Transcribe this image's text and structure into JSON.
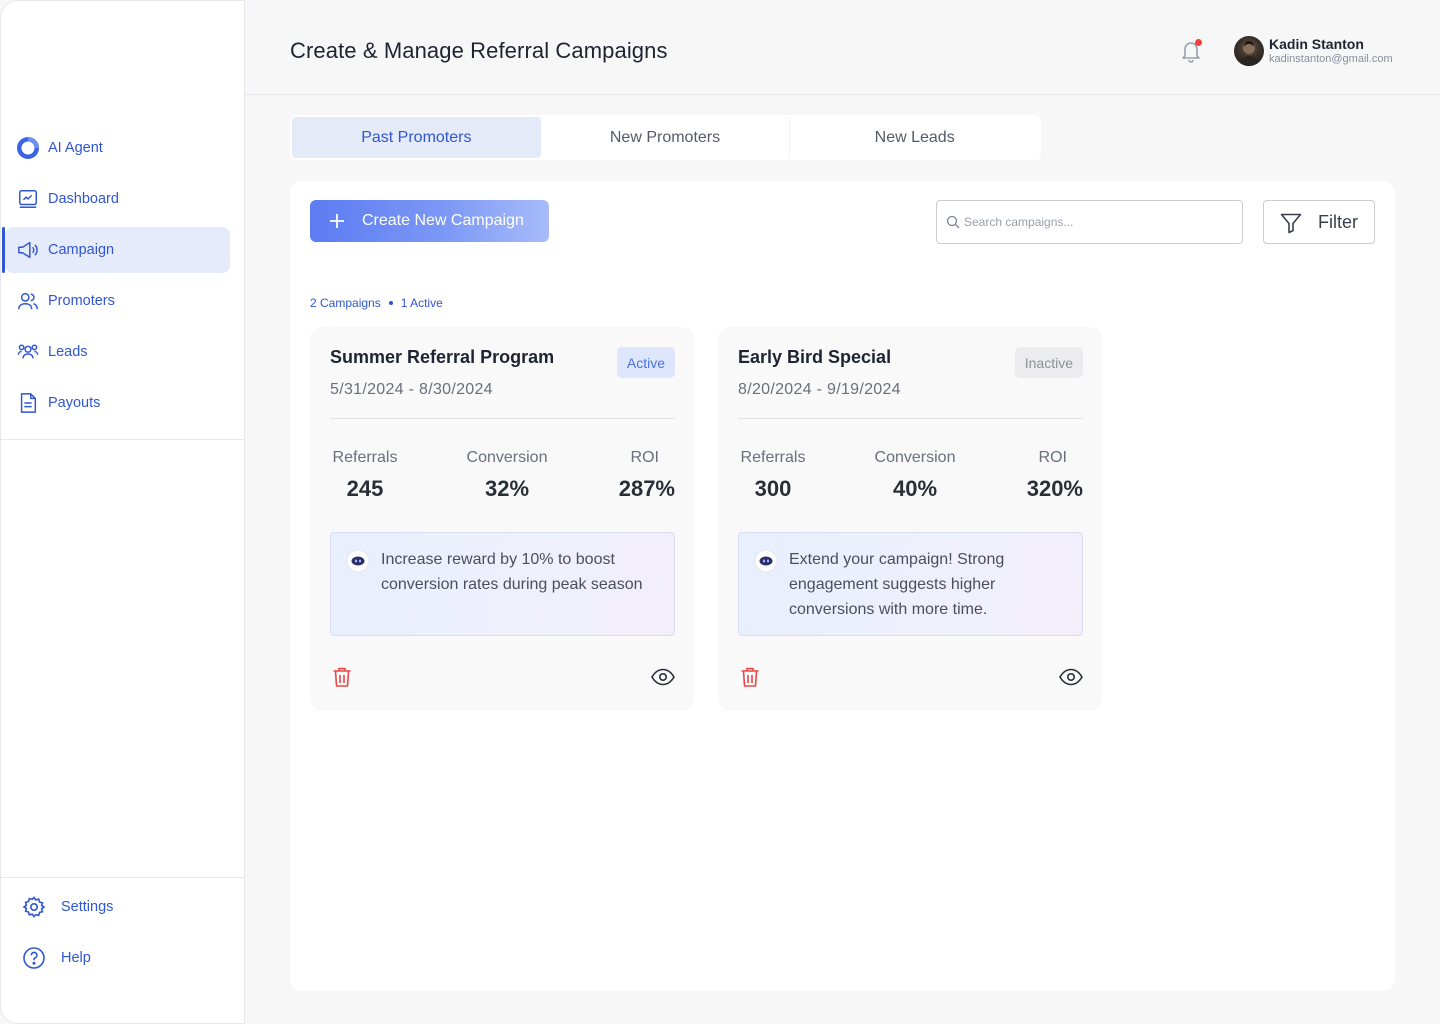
{
  "sidebar": {
    "items": [
      {
        "label": "AI Agent",
        "icon": "ai-agent-icon"
      },
      {
        "label": "Dashboard",
        "icon": "dashboard-icon"
      },
      {
        "label": "Campaign",
        "icon": "megaphone-icon",
        "active": true
      },
      {
        "label": "Promoters",
        "icon": "users-icon"
      },
      {
        "label": "Leads",
        "icon": "leads-icon"
      },
      {
        "label": "Payouts",
        "icon": "document-icon"
      }
    ],
    "bottom_items": [
      {
        "label": "Settings",
        "icon": "gear-icon"
      },
      {
        "label": "Help",
        "icon": "help-icon"
      }
    ]
  },
  "header": {
    "title": "Create & Manage Referral Campaigns",
    "user": {
      "name": "Kadin Stanton",
      "email": "kadinstanton@gmail.com"
    },
    "notification_dot": true
  },
  "tabs": [
    {
      "label": "Past Promoters",
      "active": true
    },
    {
      "label": "New Promoters",
      "active": false
    },
    {
      "label": "New Leads",
      "active": false
    }
  ],
  "toolbar": {
    "create_label": "Create New Campaign",
    "search_placeholder": "Search campaigns...",
    "filter_label": "Filter"
  },
  "summary": {
    "campaigns": "2 Campaigns",
    "active": "1 Active"
  },
  "campaigns": [
    {
      "name": "Summer Referral Program",
      "dates": "5/31/2024 - 8/30/2024",
      "status": "Active",
      "stats": {
        "referrals_label": "Referrals",
        "referrals": "245",
        "conversion_label": "Conversion",
        "conversion": "32%",
        "roi_label": "ROI",
        "roi": "287%"
      },
      "tip": "Increase reward by 10% to boost conversion rates during peak season"
    },
    {
      "name": "Early Bird Special",
      "dates": "8/20/2024 - 9/19/2024",
      "status": "Inactive",
      "stats": {
        "referrals_label": "Referrals",
        "referrals": "300",
        "conversion_label": "Conversion",
        "conversion": "40%",
        "roi_label": "ROI",
        "roi": "320%"
      },
      "tip": "Extend your campaign! Strong engagement suggests higher conversions with more time."
    }
  ],
  "colors": {
    "accent": "#3056d3",
    "active_badge_bg": "#dde6fb",
    "inactive_badge_bg": "#ececee",
    "danger": "#ef4444"
  }
}
